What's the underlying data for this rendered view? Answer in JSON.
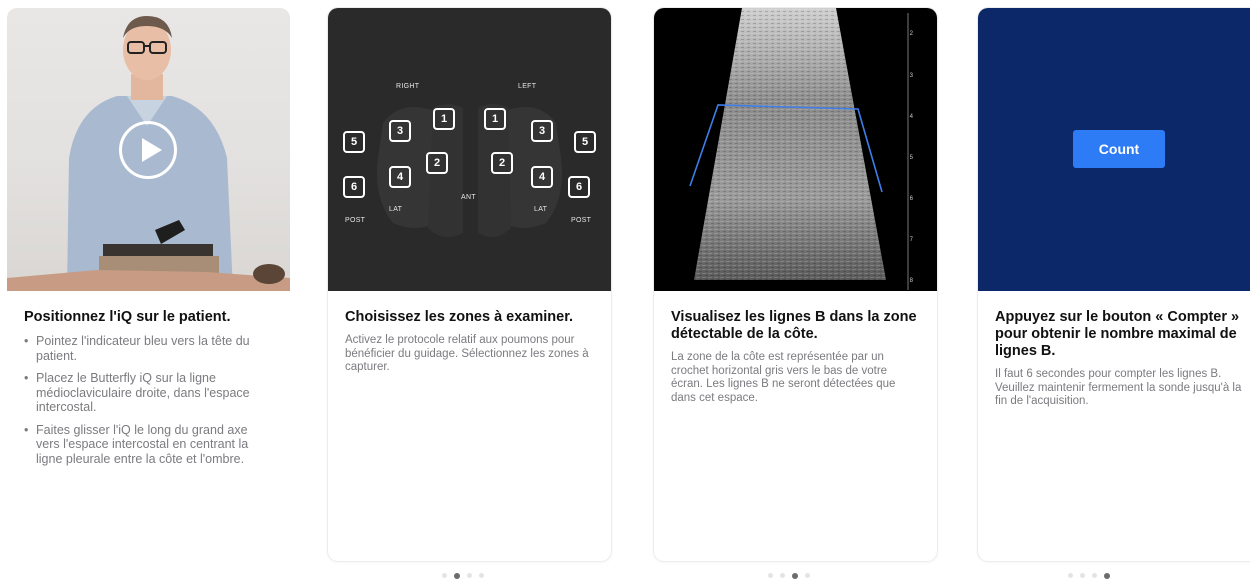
{
  "cards": [
    {
      "title": "Positionnez l'iQ sur le patient.",
      "bullets": [
        "Pointez l'indicateur bleu vers la tête du patient.",
        "Placez le Butterfly iQ sur la ligne médioclaviculaire droite, dans l'espace intercostal.",
        "Faites glisser l'iQ le long du grand axe vers l'espace intercostal en centrant la ligne pleurale entre la côte et l'ombre."
      ],
      "bullet_char": "•"
    },
    {
      "title": "Choisissez les zones à examiner.",
      "description": "Activez le protocole relatif aux poumons pour bénéficier du guidage. Sélectionnez les zones à capturer.",
      "zones": {
        "right_label": "RIGHT",
        "left_label": "LEFT",
        "ant_label": "ANT",
        "lat_left_label": "LAT",
        "lat_right_label": "LAT",
        "post_left_label": "POST",
        "post_right_label": "POST",
        "buttons": [
          "1",
          "2",
          "3",
          "4",
          "5",
          "6",
          "1",
          "2",
          "3",
          "4",
          "5",
          "6"
        ]
      },
      "page_dots": {
        "count": 4,
        "active": 2
      }
    },
    {
      "title": "Visualisez les lignes B dans la zone détectable de la côte.",
      "description": "La zone de la côte est représentée par un crochet horizontal gris vers le bas de votre écran. Les lignes B ne seront détectées que dans cet espace.",
      "depth_ticks": [
        "2",
        "3",
        "4",
        "5",
        "6",
        "7",
        "8"
      ],
      "page_dots": {
        "count": 4,
        "active": 3
      }
    },
    {
      "title": "Appuyez sur le bouton « Compter » pour obtenir le nombre maximal de lignes B.",
      "description": "Il faut 6 secondes pour compter les lignes B. Veuillez maintenir fermement la sonde jusqu'à la fin de l'acquisition.",
      "count_button": "Count",
      "page_dots": {
        "count": 4,
        "active": 4
      }
    }
  ],
  "icons": {
    "play": "play-icon"
  },
  "colors": {
    "count_bg": "#0d2868",
    "count_button": "#2e7bf6",
    "bracket": "#3f7ee8"
  }
}
